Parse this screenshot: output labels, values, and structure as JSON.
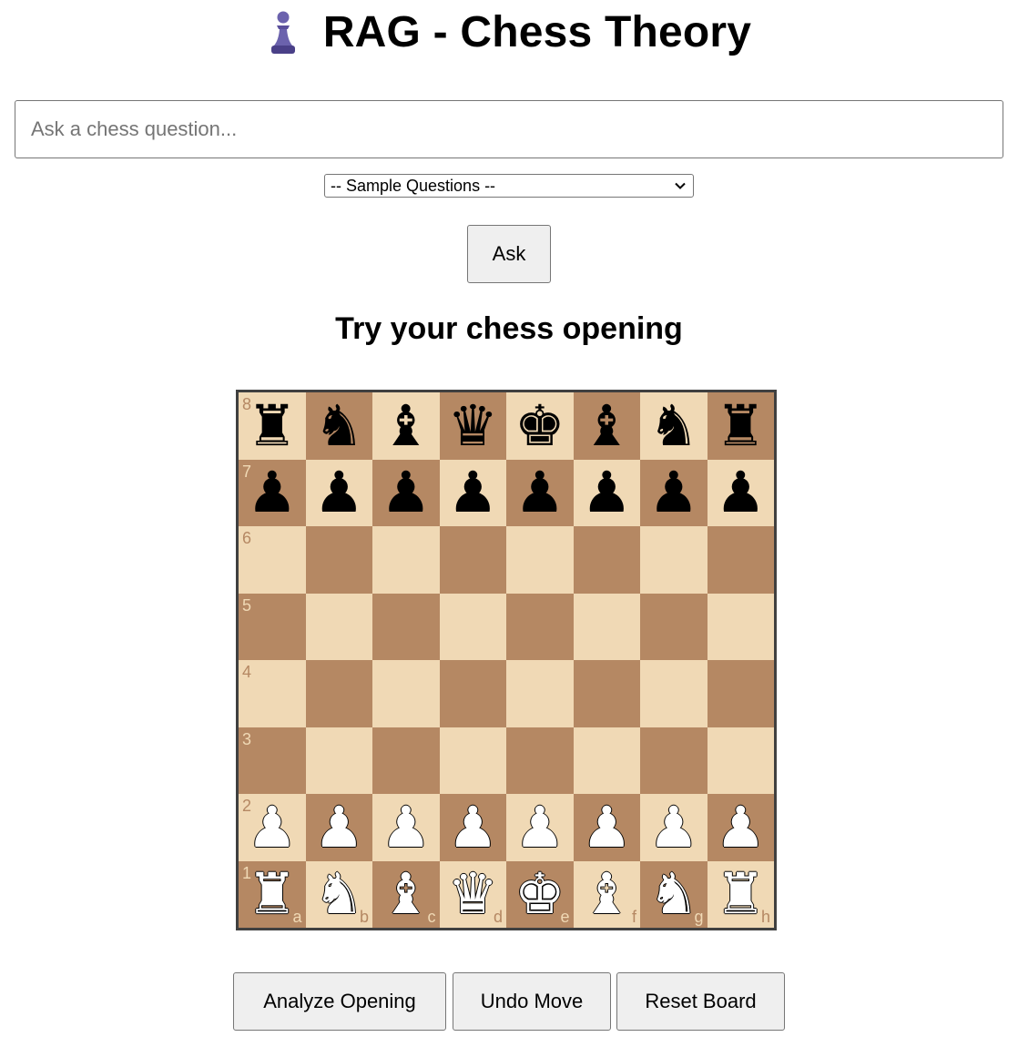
{
  "header": {
    "title": "RAG - Chess Theory",
    "icon": "pawn-icon",
    "icon_color": "#5a4f9b"
  },
  "question": {
    "placeholder": "Ask a chess question...",
    "value": ""
  },
  "samples": {
    "selected": "-- Sample Questions --"
  },
  "ask_button": "Ask",
  "opening_section": {
    "heading": "Try your chess opening"
  },
  "board": {
    "light_color": "#f0d9b5",
    "dark_color": "#b58863",
    "ranks": [
      "8",
      "7",
      "6",
      "5",
      "4",
      "3",
      "2",
      "1"
    ],
    "files": [
      "a",
      "b",
      "c",
      "d",
      "e",
      "f",
      "g",
      "h"
    ],
    "position": [
      [
        "r",
        "n",
        "b",
        "q",
        "k",
        "b",
        "n",
        "r"
      ],
      [
        "p",
        "p",
        "p",
        "p",
        "p",
        "p",
        "p",
        "p"
      ],
      [
        "",
        "",
        "",
        "",
        "",
        "",
        "",
        ""
      ],
      [
        "",
        "",
        "",
        "",
        "",
        "",
        "",
        ""
      ],
      [
        "",
        "",
        "",
        "",
        "",
        "",
        "",
        ""
      ],
      [
        "",
        "",
        "",
        "",
        "",
        "",
        "",
        ""
      ],
      [
        "P",
        "P",
        "P",
        "P",
        "P",
        "P",
        "P",
        "P"
      ],
      [
        "R",
        "N",
        "B",
        "Q",
        "K",
        "B",
        "N",
        "R"
      ]
    ]
  },
  "actions": {
    "analyze": "Analyze Opening",
    "undo": "Undo Move",
    "reset": "Reset Board"
  }
}
